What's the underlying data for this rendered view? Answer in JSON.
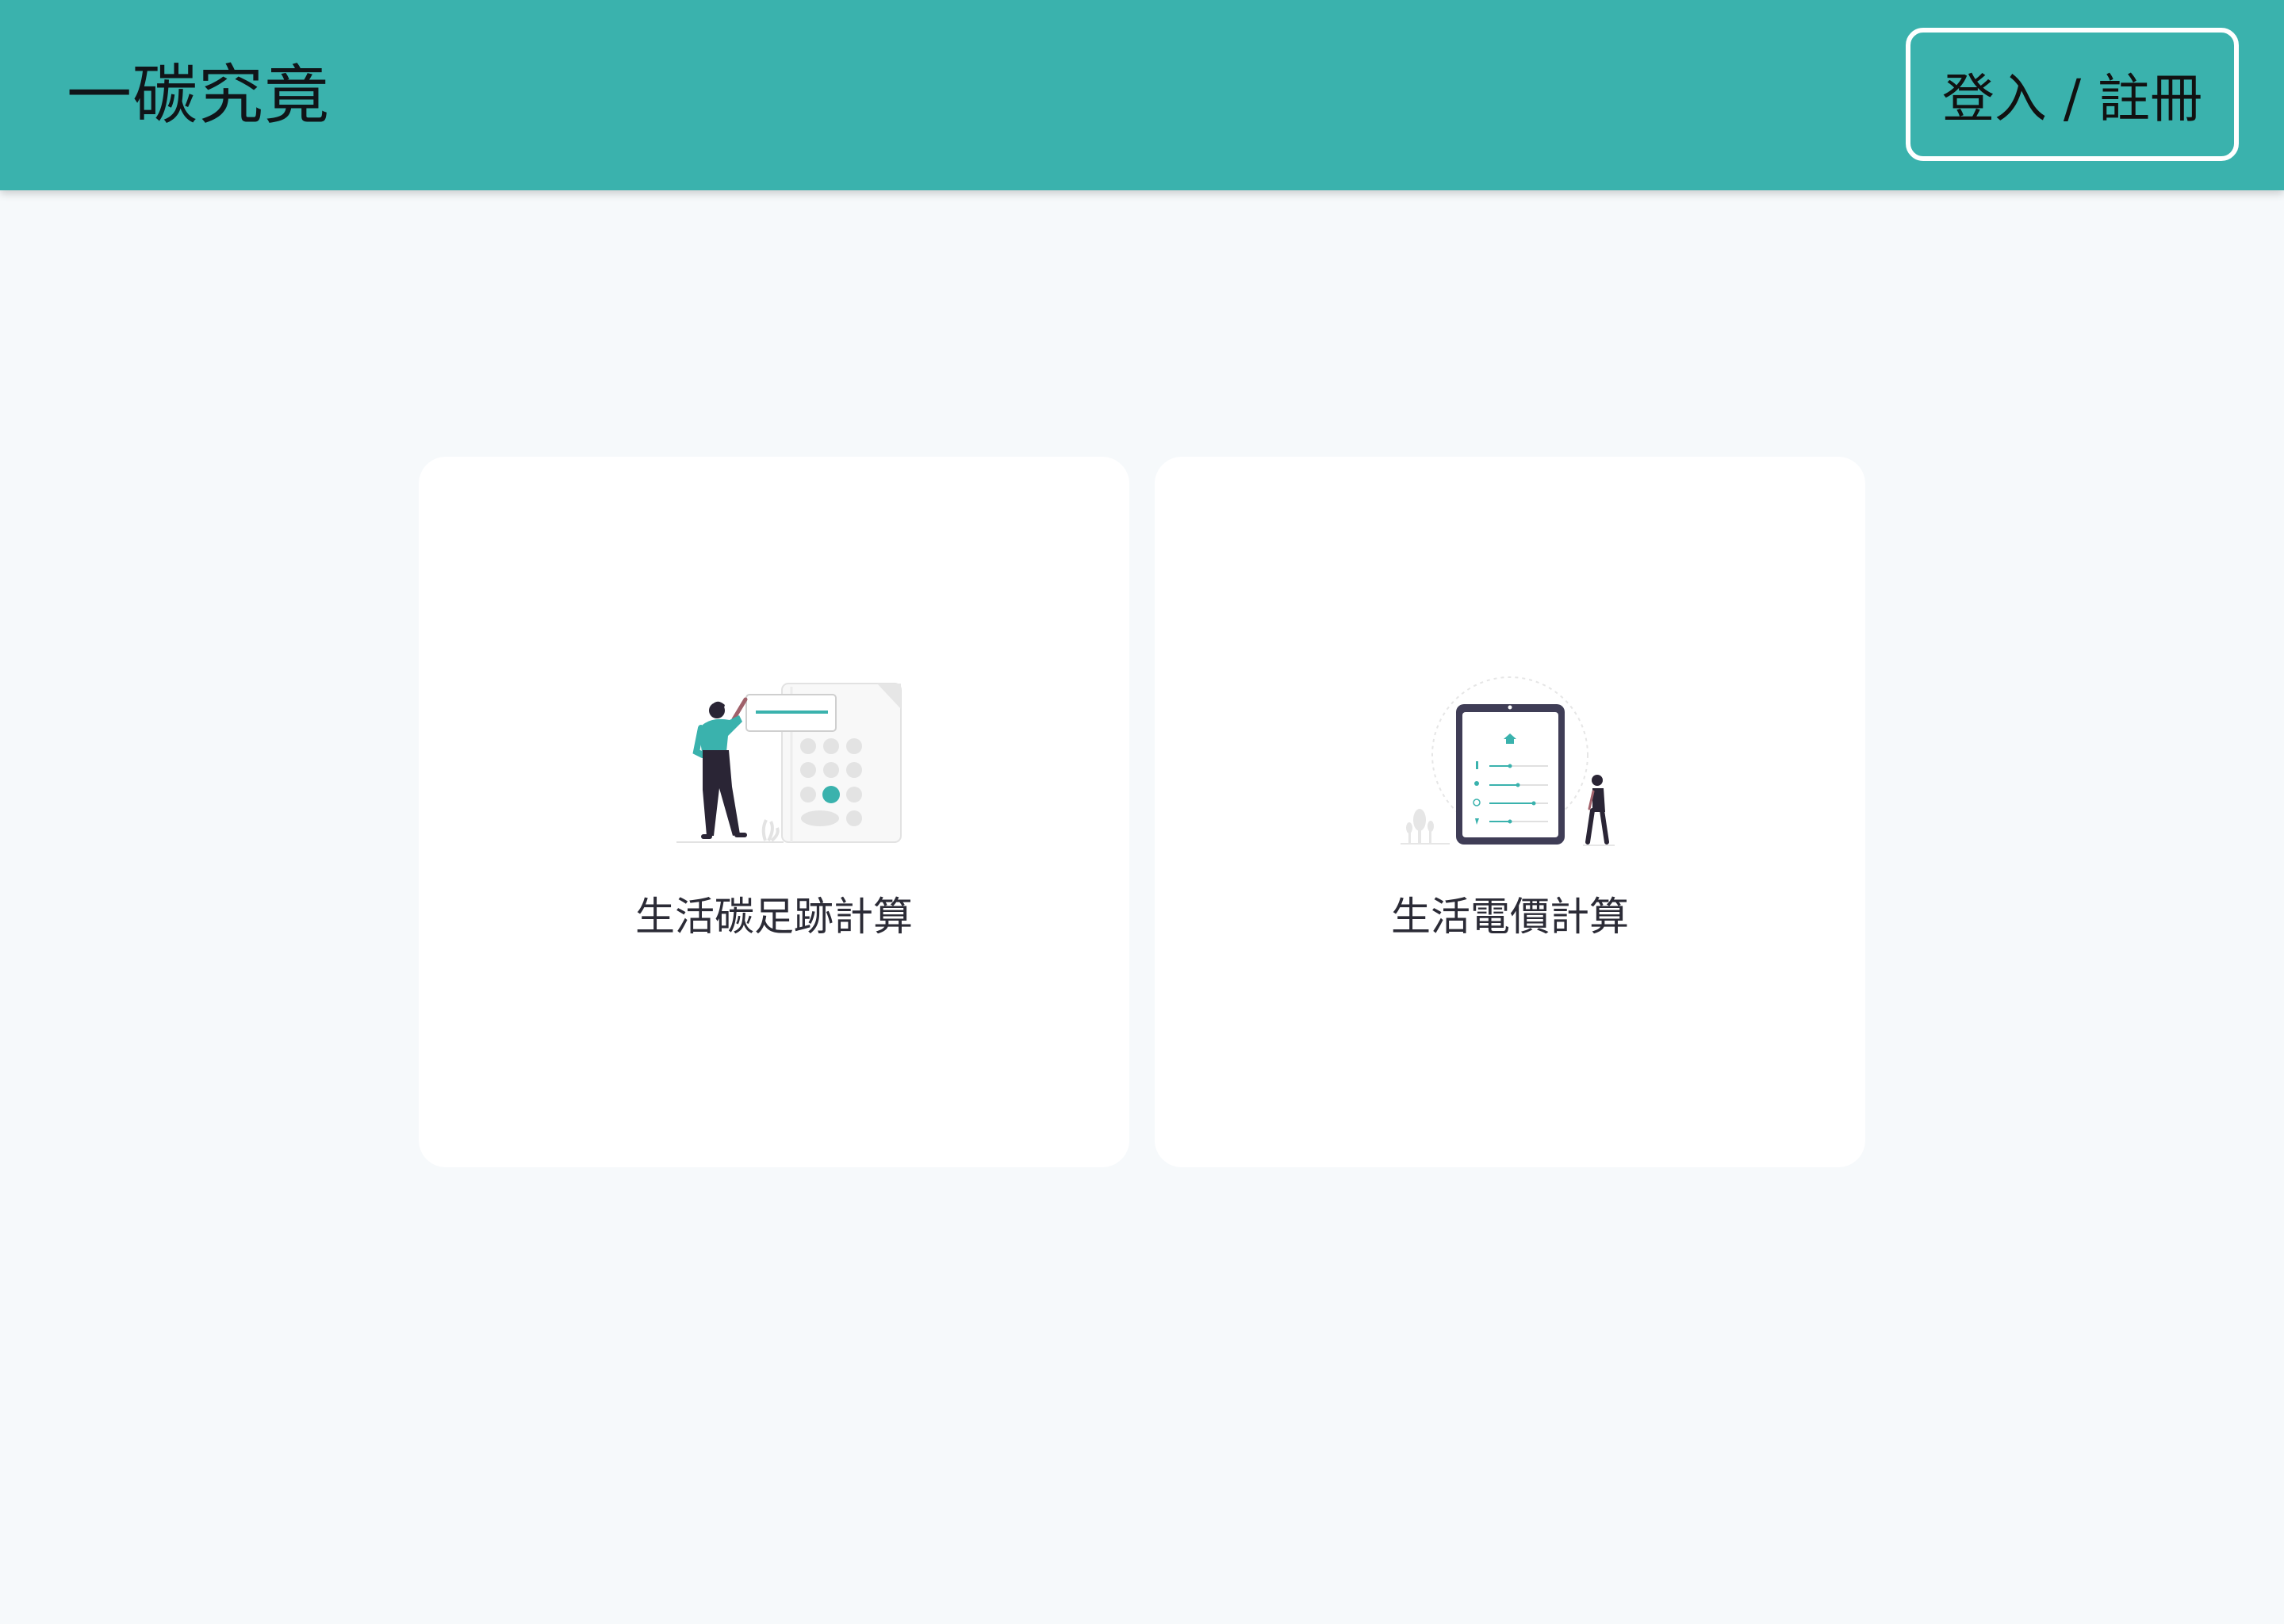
{
  "header": {
    "brand": "一碳究竟",
    "login_label": "登入 / 註冊"
  },
  "cards": [
    {
      "label": "生活碳足跡計算",
      "icon": "calculator-person-illustration"
    },
    {
      "label": "生活電價計算",
      "icon": "tablet-settings-illustration"
    }
  ],
  "colors": {
    "accent": "#3ab2ad",
    "background": "#f6f9fb",
    "card": "#ffffff",
    "text": "#2b2b36"
  }
}
